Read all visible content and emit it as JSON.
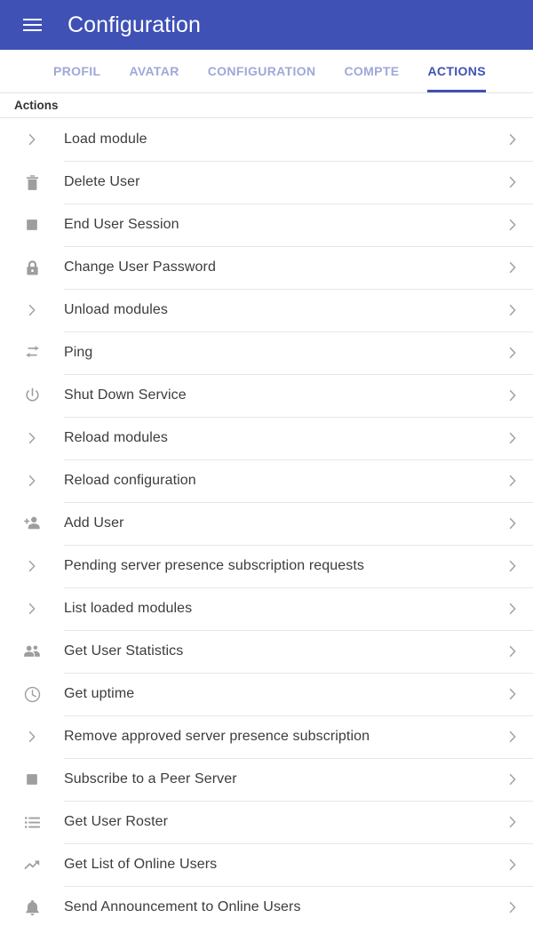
{
  "appbar": {
    "menu_icon": "hamburger-menu-icon",
    "title": "Configuration",
    "background_color": "#3f51b5",
    "text_color": "#ffffff"
  },
  "tabs": {
    "active_color": "#3f51b5",
    "inactive_color": "#9fa8da",
    "items": [
      {
        "label": "PROFIL",
        "active": false
      },
      {
        "label": "AVATAR",
        "active": false
      },
      {
        "label": "CONFIGURATION",
        "active": false
      },
      {
        "label": "COMPTE",
        "active": false
      },
      {
        "label": "ACTIONS",
        "active": true
      }
    ]
  },
  "section": {
    "title": "Actions"
  },
  "list": {
    "trailing_icon": "chevron-right-icon",
    "icon_color": "#9e9e9e",
    "label_color": "#3c3c3c",
    "items": [
      {
        "label": "Load module",
        "icon": "chevron-right-icon"
      },
      {
        "label": "Delete User",
        "icon": "trash-icon"
      },
      {
        "label": "End User Session",
        "icon": "stop-square-icon"
      },
      {
        "label": "Change User Password",
        "icon": "lock-icon"
      },
      {
        "label": "Unload modules",
        "icon": "chevron-right-icon"
      },
      {
        "label": "Ping",
        "icon": "swap-arrows-icon"
      },
      {
        "label": "Shut Down Service",
        "icon": "power-icon"
      },
      {
        "label": "Reload modules",
        "icon": "chevron-right-icon"
      },
      {
        "label": "Reload configuration",
        "icon": "chevron-right-icon"
      },
      {
        "label": "Add User",
        "icon": "person-add-icon"
      },
      {
        "label": "Pending server presence subscription requests",
        "icon": "chevron-right-icon"
      },
      {
        "label": "List loaded modules",
        "icon": "chevron-right-icon"
      },
      {
        "label": "Get User Statistics",
        "icon": "people-icon"
      },
      {
        "label": "Get uptime",
        "icon": "clock-icon"
      },
      {
        "label": "Remove approved server presence subscription",
        "icon": "chevron-right-icon"
      },
      {
        "label": "Subscribe to a Peer Server",
        "icon": "stop-square-icon"
      },
      {
        "label": "Get User Roster",
        "icon": "list-bullet-icon"
      },
      {
        "label": "Get List of Online Users",
        "icon": "trending-up-icon"
      },
      {
        "label": "Send Announcement to Online Users",
        "icon": "bell-icon"
      }
    ]
  }
}
